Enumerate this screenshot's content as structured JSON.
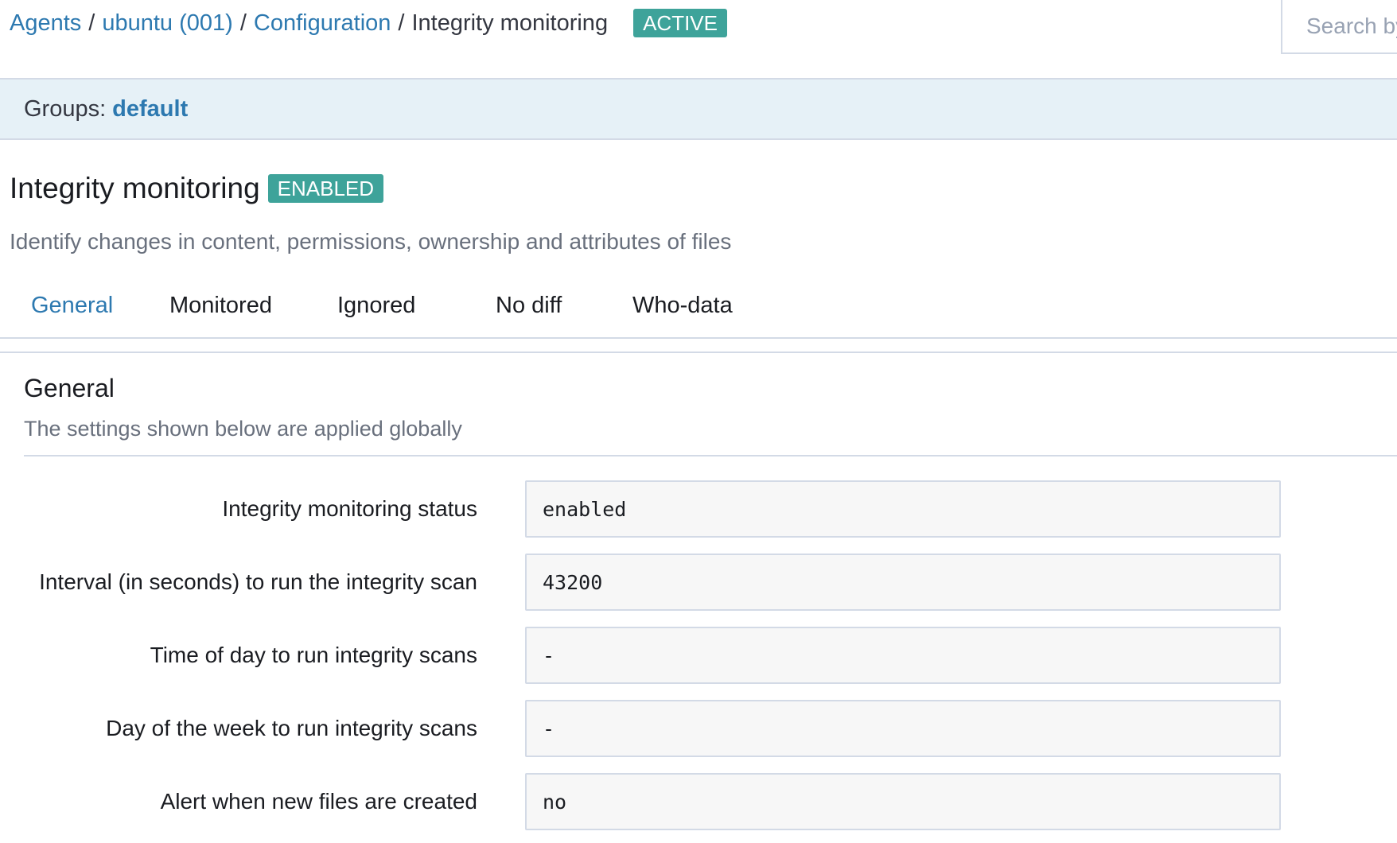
{
  "breadcrumb": {
    "agents": "Agents",
    "agent": "ubuntu (001)",
    "configuration": "Configuration",
    "current": "Integrity monitoring",
    "separator": "/"
  },
  "agent_status": "ACTIVE",
  "search": {
    "placeholder": "Search by"
  },
  "groups": {
    "label": "Groups:",
    "value": "default"
  },
  "section": {
    "title": "Integrity monitoring",
    "badge": "ENABLED",
    "description": "Identify changes in content, permissions, ownership and attributes of files"
  },
  "tabs": [
    {
      "label": "General",
      "active": true
    },
    {
      "label": "Monitored",
      "active": false
    },
    {
      "label": "Ignored",
      "active": false
    },
    {
      "label": "No diff",
      "active": false
    },
    {
      "label": "Who-data",
      "active": false
    }
  ],
  "panel": {
    "title": "General",
    "description": "The settings shown below are applied globally"
  },
  "fields": [
    {
      "label": "Integrity monitoring status",
      "value": "enabled"
    },
    {
      "label": "Interval (in seconds) to run the integrity scan",
      "value": "43200"
    },
    {
      "label": "Time of day to run integrity scans",
      "value": "-"
    },
    {
      "label": "Day of the week to run integrity scans",
      "value": "-"
    },
    {
      "label": "Alert when new files are created",
      "value": "no"
    }
  ],
  "colors": {
    "link": "#2d79b0",
    "badge": "#3ea39a",
    "groups_bar": "#e6f1f7"
  }
}
